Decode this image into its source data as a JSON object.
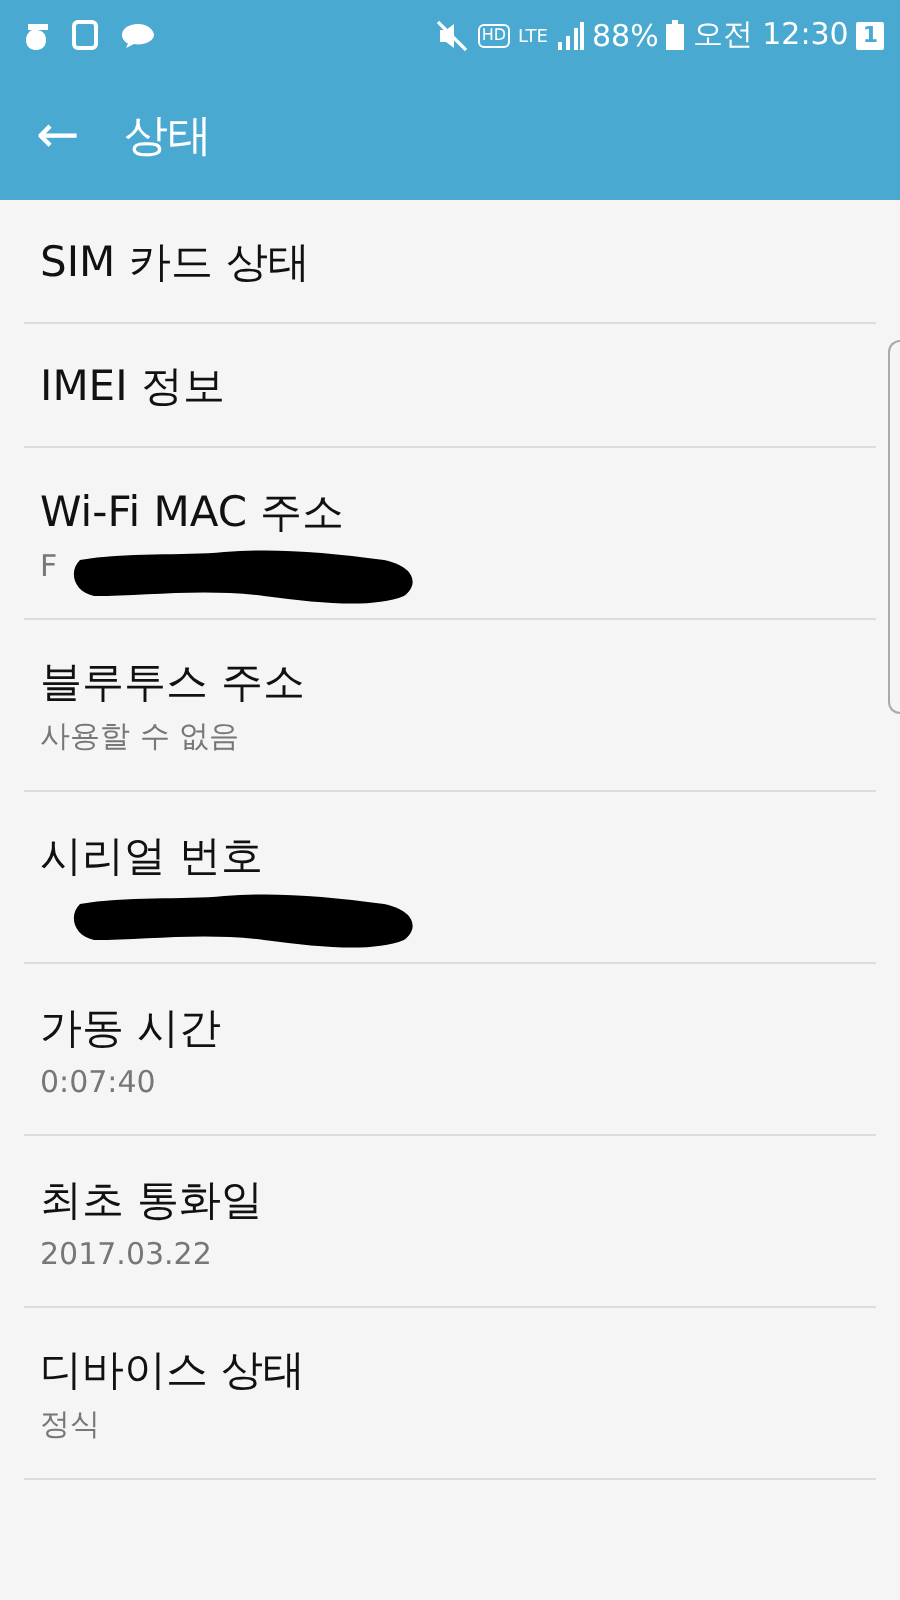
{
  "status_bar": {
    "hd": "HD",
    "network": "LTE",
    "battery": "88%",
    "time": "오전 12:30",
    "badge": "1"
  },
  "app_bar": {
    "back": "←",
    "title": "상태"
  },
  "items": [
    {
      "title": "SIM 카드 상태"
    },
    {
      "title": "IMEI 정보"
    },
    {
      "title": "Wi-Fi MAC 주소",
      "value": "F",
      "redacted": true
    },
    {
      "title": "블루투스 주소",
      "value": "사용할 수 없음",
      "redacted": false
    },
    {
      "title": "시리얼 번호",
      "redacted": true
    },
    {
      "title": "가동 시간",
      "value": "0:07:40",
      "redacted": false
    },
    {
      "title": "최초 통화일",
      "value": "2017.03.22",
      "redacted": false
    },
    {
      "title": "디바이스 상태",
      "value": "정식",
      "redacted": false
    }
  ]
}
